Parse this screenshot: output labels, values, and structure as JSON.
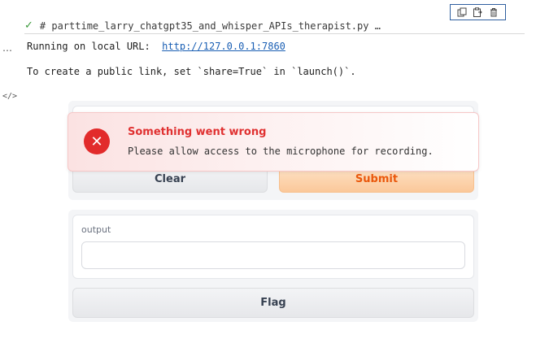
{
  "cell": {
    "header_text": "# parttime_larry_chatgpt35_and_whisper_APIs_therapist.py …",
    "status_icon": "check-icon",
    "left_gutter_ellipsis": "…",
    "left_gutter_code_icon": "</>"
  },
  "toolbar": {
    "icons": [
      "copy-icon",
      "paste-icon",
      "delete-icon"
    ]
  },
  "output": {
    "line1_prefix": "Running on local URL:  ",
    "line1_link": "http://127.0.0.1:7860",
    "line2": "To create a public link, set `share=True` in `launch()`."
  },
  "app": {
    "clear_label": "Clear",
    "submit_label": "Submit",
    "output_label": "output",
    "output_value": "",
    "flag_label": "Flag"
  },
  "toast": {
    "title": "Something went wrong",
    "message": "Please allow access to the microphone for recording.",
    "icon": "error-x-icon",
    "accent": "#e22b2b"
  }
}
